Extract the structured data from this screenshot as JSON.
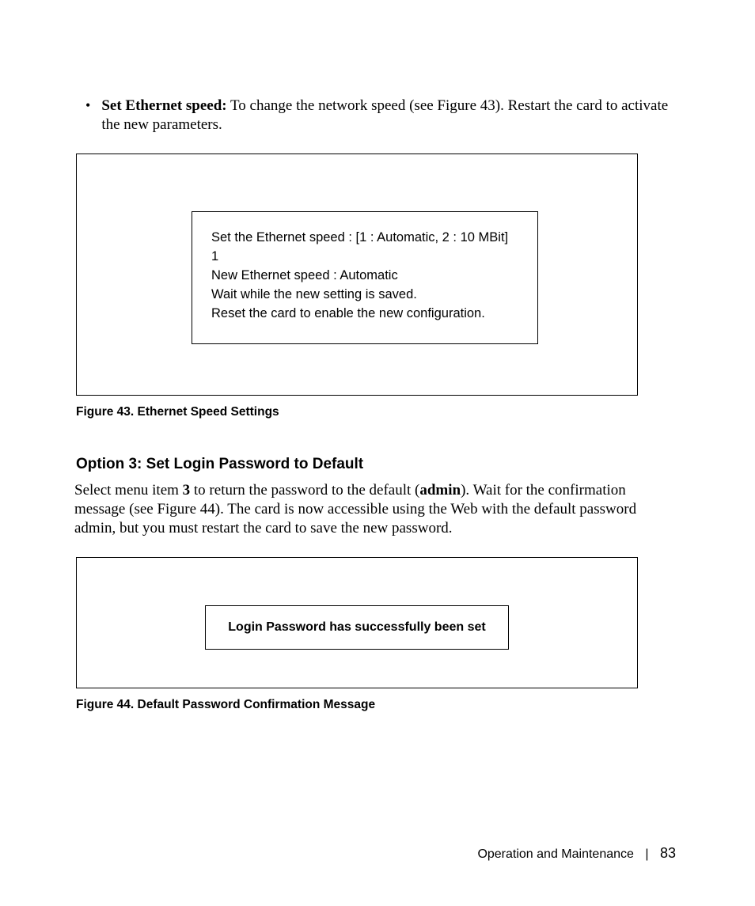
{
  "bullet": {
    "dot": "•",
    "label": "Set Ethernet speed:",
    "text_after": " To change the network speed (see Figure 43). Restart the card to activate the new parameters."
  },
  "figure43": {
    "line1": "Set the Ethernet speed : [1 : Automatic, 2 : 10 MBit]",
    "line2": "1",
    "line3": "New Ethernet speed : Automatic",
    "line4": "Wait while the new setting is saved.",
    "line5": "Reset the card to enable the new configuration."
  },
  "caption43": "Figure 43. Ethernet Speed Settings",
  "heading": "Option 3: Set Login Password to Default",
  "para": {
    "prefix": "Select menu item ",
    "bold1": "3",
    "mid1": " to return the password to the default (",
    "bold2": "admin",
    "mid2": "). Wait for the confirmation message (see Figure 44). The card is now accessible using the Web with the default password admin, but you must restart the card to save the new password."
  },
  "figure44_text": "Login Password has successfully been set",
  "caption44": "Figure 44. Default Password Confirmation Message",
  "footer": {
    "section": "Operation and Maintenance",
    "sep": "|",
    "page": "83"
  }
}
